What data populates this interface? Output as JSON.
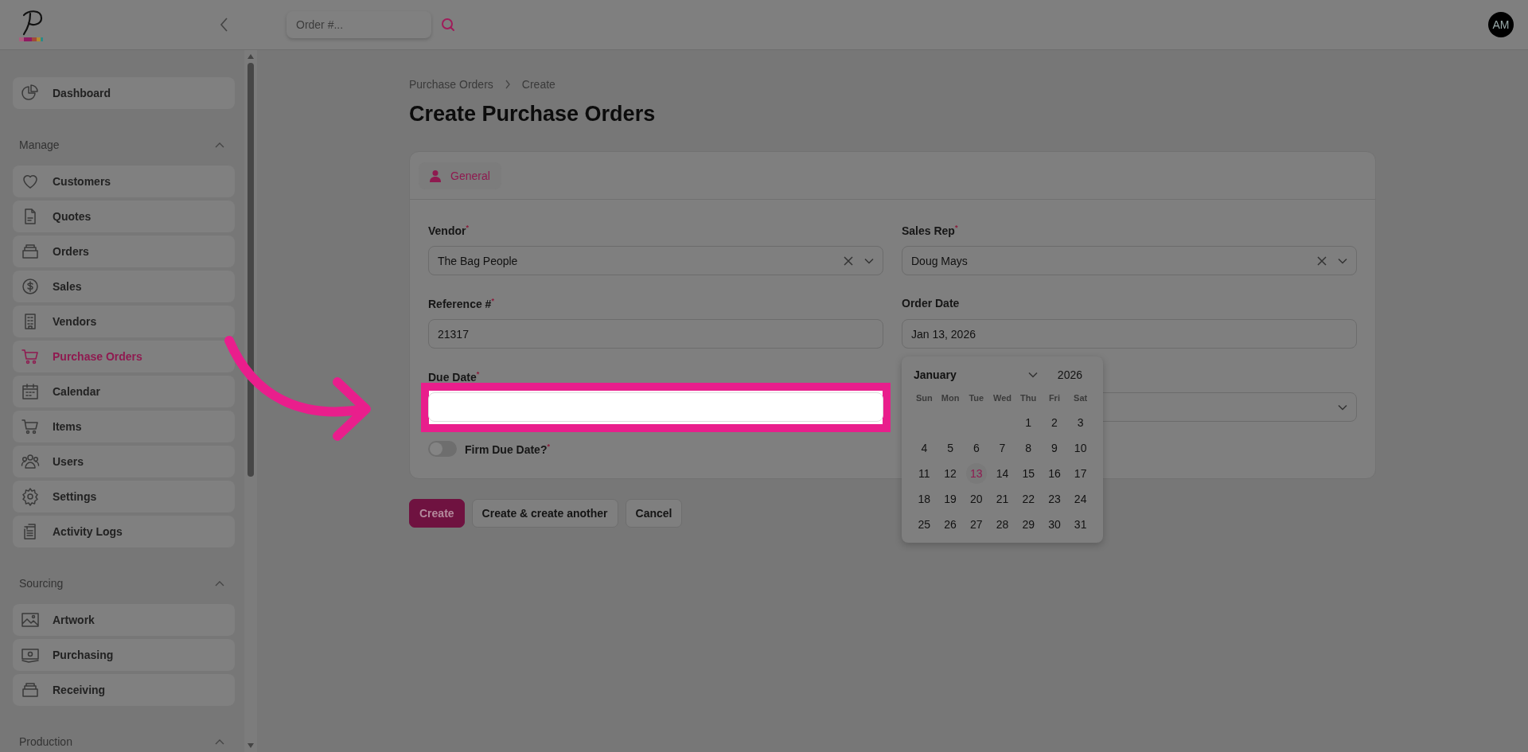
{
  "header": {
    "search": {
      "placeholder": "Order #..."
    },
    "avatar": "AM"
  },
  "sidebar": {
    "groups": [
      {
        "items": [
          {
            "label": "Dashboard",
            "selected": false
          }
        ]
      },
      {
        "title": "Manage",
        "expanded": true,
        "items": [
          {
            "label": "Customers",
            "selected": false
          },
          {
            "label": "Quotes",
            "selected": false
          },
          {
            "label": "Orders",
            "selected": false
          },
          {
            "label": "Sales",
            "selected": false
          },
          {
            "label": "Vendors",
            "selected": false
          },
          {
            "label": "Purchase Orders",
            "selected": true
          },
          {
            "label": "Calendar",
            "selected": false
          },
          {
            "label": "Items",
            "selected": false
          },
          {
            "label": "Users",
            "selected": false
          },
          {
            "label": "Settings",
            "selected": false
          },
          {
            "label": "Activity Logs",
            "selected": false
          }
        ]
      },
      {
        "title": "Sourcing",
        "expanded": true,
        "items": [
          {
            "label": "Artwork",
            "selected": false
          },
          {
            "label": "Purchasing",
            "selected": false
          },
          {
            "label": "Receiving",
            "selected": false
          }
        ]
      },
      {
        "title": "Production",
        "expanded": true
      }
    ]
  },
  "breadcrumb": [
    "Purchase Orders",
    "Create"
  ],
  "title": "Create Purchase Orders",
  "form": {
    "tabs": [
      {
        "label": "General",
        "selected": true
      }
    ],
    "fields": [
      {
        "kind": "select",
        "label": "Vendor$^{*}$",
        "value": "The Bag People",
        "clearable": true,
        "highlighted": false
      },
      {
        "kind": "select",
        "label": "Sales Rep$^{*}$",
        "value": "Doug Mays",
        "clearable": true,
        "highlighted": false
      },
      {
        "kind": "text",
        "label": "Reference #$^{*}$",
        "value": "21317",
        "highlighted": false
      },
      {
        "kind": "text",
        "label": "Order Date",
        "value": "Jan 13, 2026",
        "highlighted": false
      },
      {
        "kind": "text",
        "label": "Due Date$^{*}$",
        "highlighted": true
      },
      {
        "kind": "select",
        "clearable": false,
        "highlighted": false
      }
    ],
    "toggle": {
      "label": "Firm Due Date?$^{*}$",
      "on": false
    }
  },
  "buttons": [
    {
      "label": "Create",
      "kind": "primary"
    },
    {
      "label": "Create & create another",
      "kind": "secondary"
    },
    {
      "label": "Cancel",
      "kind": "secondary"
    }
  ],
  "calendar": {
    "month": "January",
    "year": "2026",
    "weekdays": [
      "Sun",
      "Mon",
      "Tue",
      "Wed",
      "Thu",
      "Fri",
      "Sat"
    ],
    "weeks": [
      [
        {
          "label": "1",
          "today": false
        },
        {
          "label": "2",
          "today": false
        },
        {
          "label": "3",
          "today": false
        }
      ],
      [
        {
          "label": "4",
          "today": false
        },
        {
          "label": "5",
          "today": false
        },
        {
          "label": "6",
          "today": false
        },
        {
          "label": "7",
          "today": false
        },
        {
          "label": "8",
          "today": false
        },
        {
          "label": "9",
          "today": false
        },
        {
          "label": "10",
          "today": false
        }
      ],
      [
        {
          "label": "11",
          "today": false
        },
        {
          "label": "12",
          "today": false
        },
        {
          "label": "13",
          "today": true
        },
        {
          "label": "14",
          "today": false
        },
        {
          "label": "15",
          "today": false
        },
        {
          "label": "16",
          "today": false
        },
        {
          "label": "17",
          "today": false
        }
      ],
      [
        {
          "label": "18",
          "today": false
        },
        {
          "label": "19",
          "today": false
        },
        {
          "label": "20",
          "today": false
        },
        {
          "label": "21",
          "today": false
        },
        {
          "label": "22",
          "today": false
        },
        {
          "label": "23",
          "today": false
        },
        {
          "label": "24",
          "today": false
        }
      ],
      [
        {
          "label": "25",
          "today": false
        },
        {
          "label": "26",
          "today": false
        },
        {
          "label": "27",
          "today": false
        },
        {
          "label": "28",
          "today": false
        },
        {
          "label": "29",
          "today": false
        },
        {
          "label": "30",
          "today": false
        },
        {
          "label": "31",
          "today": false
        }
      ]
    ]
  }
}
